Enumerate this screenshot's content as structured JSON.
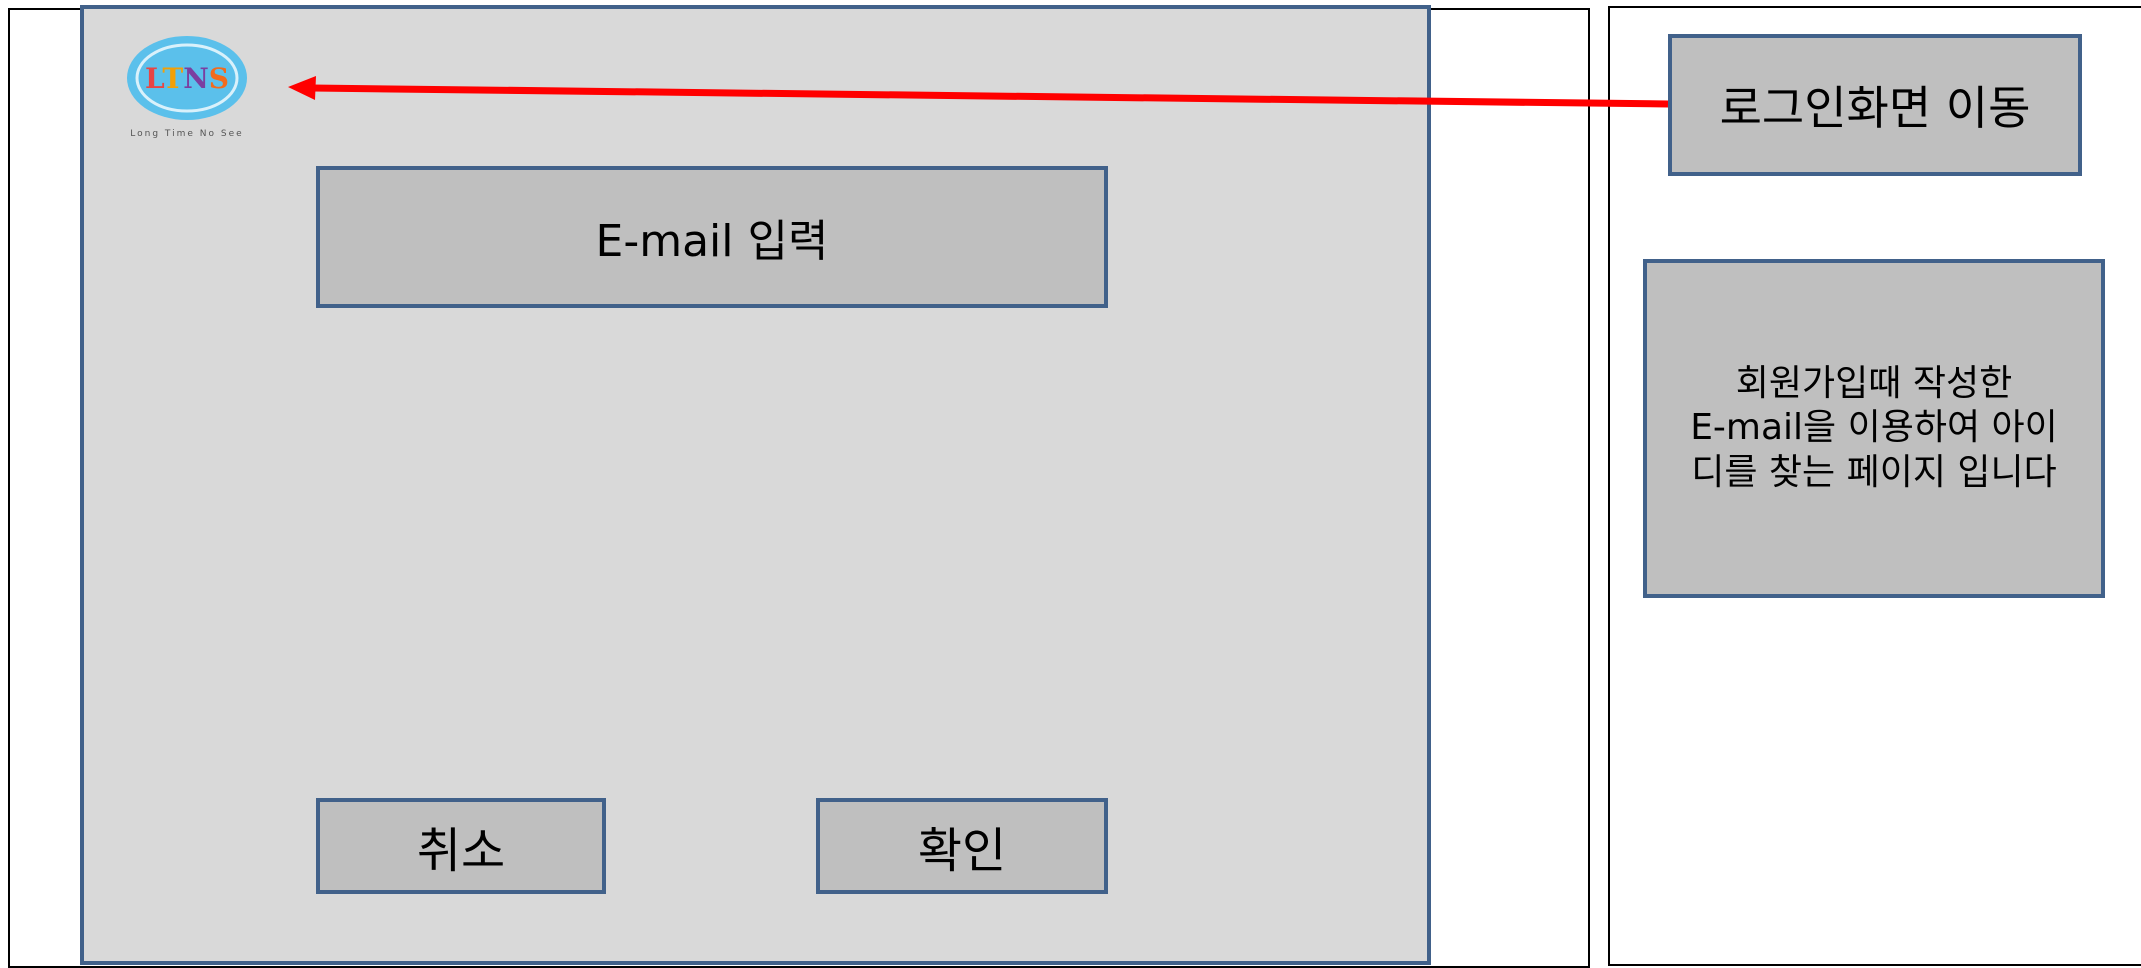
{
  "logo": {
    "mark_text": "LTNS",
    "tagline": "Long Time No See"
  },
  "form": {
    "email_placeholder": "E-mail 입력",
    "cancel_label": "취소",
    "confirm_label": "확인"
  },
  "annotations": {
    "login_move_label": "로그인화면 이동",
    "description_lines": [
      "회원가입때 작성한",
      "E-mail을 이용하여 아이",
      "디를 찾는 페이지 입니다"
    ]
  },
  "colors": {
    "screen_bg": "#d9d9d9",
    "box_bg": "#bfbfbf",
    "box_border": "#41618a",
    "arrow": "#ff0000",
    "logo_circle": "#5bc0eb"
  }
}
